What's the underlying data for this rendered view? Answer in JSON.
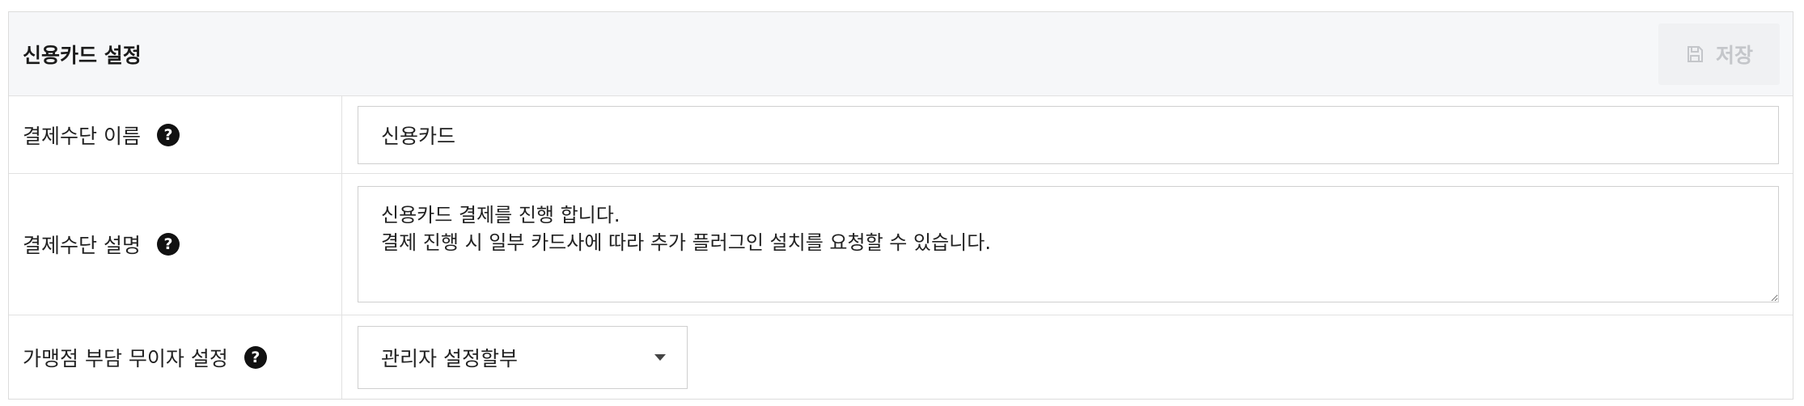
{
  "panel": {
    "title": "신용카드 설정",
    "save_label": "저장"
  },
  "fields": {
    "name": {
      "label": "결제수단 이름",
      "help": "?",
      "value": "신용카드"
    },
    "description": {
      "label": "결제수단 설명",
      "help": "?",
      "value": "신용카드 결제를 진행 합니다.\n결제 진행 시 일부 카드사에 따라 추가 플러그인 설치를 요청할 수 있습니다."
    },
    "installment": {
      "label": "가맹점 부담 무이자 설정",
      "help": "?",
      "selected": "관리자 설정할부"
    }
  },
  "colors": {
    "header_bg": "#f6f7f9",
    "save_button_text": "#c4c6ca",
    "help_icon_bg": "#111111"
  },
  "icons": {
    "save": "floppy-disk-icon",
    "help": "question-circle-icon",
    "select": "caret-down-icon"
  }
}
